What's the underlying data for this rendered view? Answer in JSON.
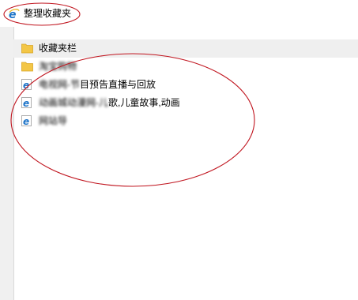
{
  "window": {
    "title": "整理收藏夹",
    "icon": "ie-e-icon"
  },
  "favorites": [
    {
      "type": "folder",
      "label": "收藏夹栏",
      "selected": true,
      "obscured": false
    },
    {
      "type": "folder",
      "label": "淘宝购物",
      "selected": false,
      "obscured": true
    },
    {
      "type": "link",
      "prefix": "电视网-节",
      "label": "目预告直播与回放",
      "selected": false,
      "obscured": "partial"
    },
    {
      "type": "link",
      "prefix": "动画城动漫网-儿",
      "label": "歌,儿童故事,动画",
      "selected": false,
      "obscured": "partial"
    },
    {
      "type": "link",
      "label": "网站导",
      "selected": false,
      "obscured": true
    }
  ],
  "colors": {
    "annotation": "#c0141e",
    "folder": "#f3c646",
    "ie_blue": "#1e74c8"
  }
}
